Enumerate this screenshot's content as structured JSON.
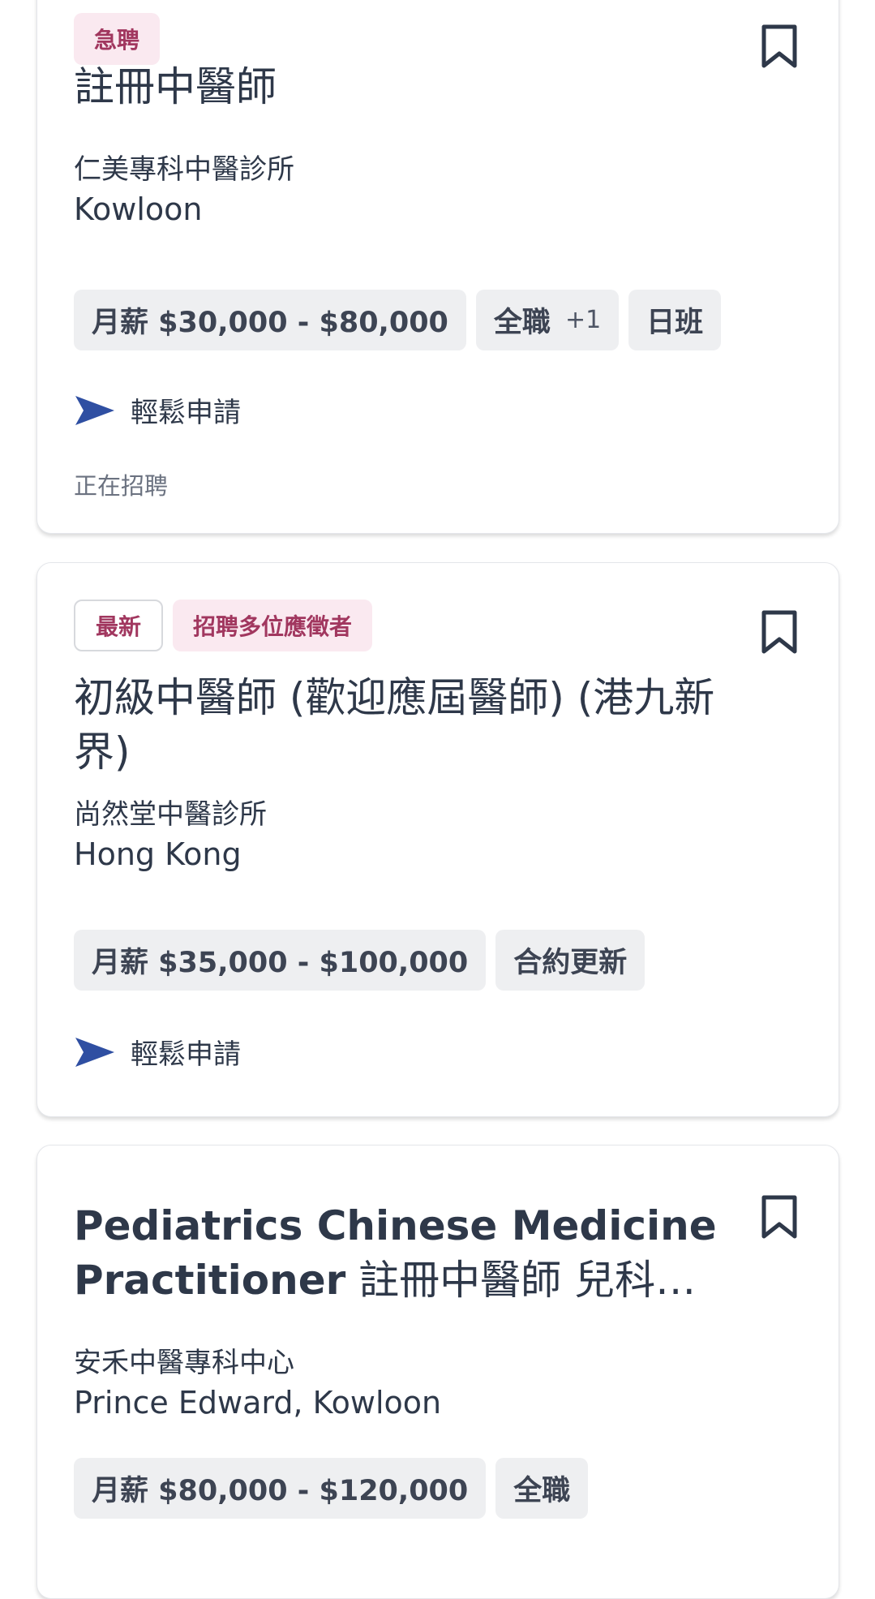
{
  "jobs": [
    {
      "badges": [
        {
          "label": "急聘",
          "style": "filled"
        }
      ],
      "title": "註冊中醫師",
      "company": "仁美專科中醫診所",
      "location": "Kowloon",
      "salary": "月薪 $30,000 - $80,000",
      "tags": [
        "全職",
        "日班"
      ],
      "tag_extra": "+1",
      "apply_label": "輕鬆申請",
      "status": "正在招聘"
    },
    {
      "badges": [
        {
          "label": "最新",
          "style": "outline"
        },
        {
          "label": "招聘多位應徵者",
          "style": "filled"
        }
      ],
      "title": "初級中醫師 (歡迎應屆醫師) (港九新界)",
      "company": "尚然堂中醫診所",
      "location": "Hong Kong",
      "salary": "月薪 $35,000 - $100,000",
      "tags": [
        "合約更新"
      ],
      "apply_label": "輕鬆申請"
    },
    {
      "title_latin": "Pediatrics Chinese Medicine Practitioner",
      "title_cjk": "註冊中醫師 兒科…",
      "company": "安禾中醫專科中心",
      "location": "Prince Edward, Kowloon",
      "salary": "月薪 $80,000 - $120,000",
      "tags": [
        "全職"
      ]
    }
  ],
  "icons": {
    "bookmark": "bookmark-icon",
    "apply": "send-arrow-icon"
  },
  "colors": {
    "badge_text": "#a1375f",
    "badge_bg": "#fae9f0",
    "apply_icon": "#2f4fa2",
    "chip_bg": "#eeeff1"
  }
}
